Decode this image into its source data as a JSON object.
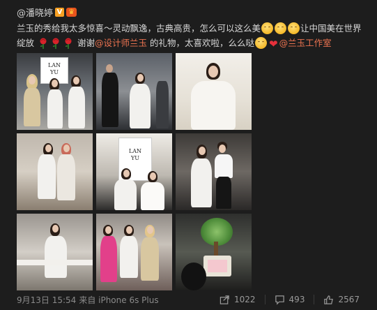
{
  "post": {
    "author": "@潘晓婷",
    "badge_v": "V",
    "badge_crown": "♛",
    "text_part1": "兰玉的秀给我太多惊喜～灵动飘逸，古典高贵，怎么可以这么美",
    "text_part2": "让中国美在世界绽放",
    "text_part3": "谢谢",
    "mention_designer": "@设计师兰玉",
    "text_part4": "的礼物，太喜欢啦，么么哒",
    "mention_studio": "@兰玉工作室",
    "sign_text": "LAN\nYU"
  },
  "photos": [
    {
      "name": "photo-1"
    },
    {
      "name": "photo-2"
    },
    {
      "name": "photo-3"
    },
    {
      "name": "photo-4"
    },
    {
      "name": "photo-5"
    },
    {
      "name": "photo-6"
    },
    {
      "name": "photo-7"
    },
    {
      "name": "photo-8"
    },
    {
      "name": "photo-9"
    }
  ],
  "footer": {
    "date": "9月13日 15:54",
    "source": "来自 iPhone 6s Plus",
    "share_count": "1022",
    "comment_count": "493",
    "like_count": "2567",
    "share_icon": "share-icon",
    "comment_icon": "comment-icon",
    "like_icon": "thumbs-up-icon"
  },
  "colors": {
    "link": "#eb7350",
    "background": "#1d1d1d",
    "badge_v": "#f7a023",
    "badge_crown": "#e8541c"
  }
}
